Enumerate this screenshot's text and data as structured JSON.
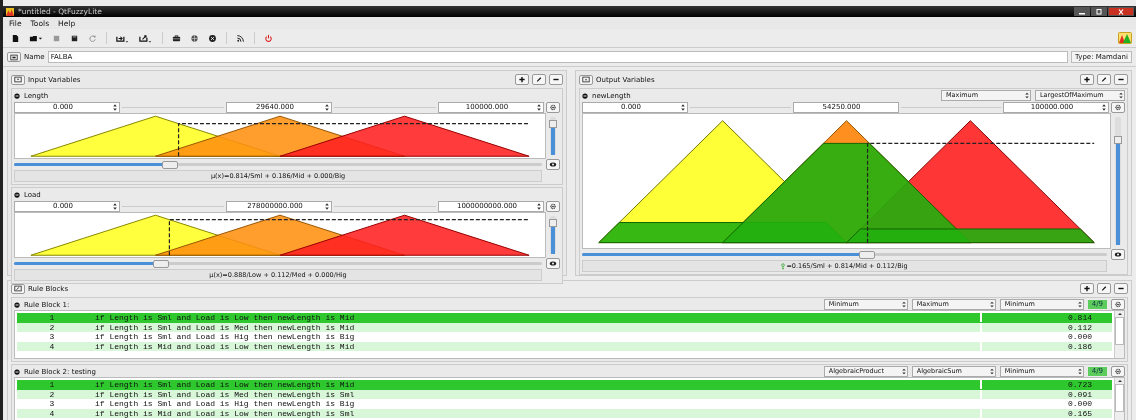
{
  "window": {
    "title": "*untitled - QtFuzzyLite"
  },
  "menu": [
    "File",
    "Tools",
    "Help"
  ],
  "engine": {
    "name_label": "Name",
    "name": "FALBA",
    "type": "Type: Mamdani"
  },
  "input_panel": {
    "title": "Input Variables"
  },
  "inputs": [
    {
      "name": "Length",
      "min": "0.000",
      "value": "29640.000",
      "max": "100000.000",
      "level": 0.2964,
      "zoom": {
        "level": 0.82
      },
      "membership": "μ(x)=0.814/Sml + 0.186/Mid + 0.000/Big"
    },
    {
      "name": "Load",
      "min": "0.000",
      "value": "278000000.000",
      "max": "1000000000.000",
      "level": 0.278,
      "zoom": {
        "level": 0.82
      },
      "membership": "μ(x)=0.888/Low + 0.112/Med + 0.000/Hig"
    }
  ],
  "output_panel": {
    "title": "Output Variables"
  },
  "outputs": [
    {
      "name": "newLength",
      "accumulation": "Maximum",
      "defuzzifier": "LargestOfMaximum",
      "min": "0.000",
      "value": "54250.000",
      "max": "100000.000",
      "level": 0.5425,
      "zoom": {
        "level": 0.82
      },
      "membership": "=0.165/Sml + 0.814/Mid + 0.112/Big"
    }
  ],
  "rule_panel": {
    "title": "Rule Blocks"
  },
  "rule_blocks": [
    {
      "name": "Rule Block 1:",
      "conjunction": "Minimum",
      "disjunction": "Maximum",
      "activation": "Minimum",
      "count": "4/9",
      "rules": [
        {
          "index": "1",
          "text": "if Length is Sml and Load is Low then newLength is Mid",
          "value": "0.814",
          "kind": "strong"
        },
        {
          "index": "2",
          "text": "if Length is Sml and Load is Med then newLength is Mid",
          "value": "0.112",
          "kind": "light"
        },
        {
          "index": "3",
          "text": "if Length is Sml and Load is Hig then newLength is Big",
          "value": "0.000",
          "kind": "plain"
        },
        {
          "index": "4",
          "text": "if Length is Mid and Load is Low then newLength is Mid",
          "value": "0.186",
          "kind": "light"
        }
      ]
    },
    {
      "name": "Rule Block 2: testing",
      "conjunction": "AlgebraicProduct",
      "disjunction": "AlgebraicSum",
      "activation": "Minimum",
      "count": "4/9",
      "rules": [
        {
          "index": "1",
          "text": "if Length is Sml and Load is Low then newLength is Mid",
          "value": "0.723",
          "kind": "strong"
        },
        {
          "index": "2",
          "text": "if Length is Sml and Load is Med then newLength is Sml",
          "value": "0.091",
          "kind": "light"
        },
        {
          "index": "3",
          "text": "if Length is Sml and Load is Hig then newLength is Big",
          "value": "0.000",
          "kind": "plain"
        },
        {
          "index": "4",
          "text": "if Length is Mid and Load is Low then newLength is Sml",
          "value": "0.165",
          "kind": "light"
        }
      ]
    }
  ]
}
